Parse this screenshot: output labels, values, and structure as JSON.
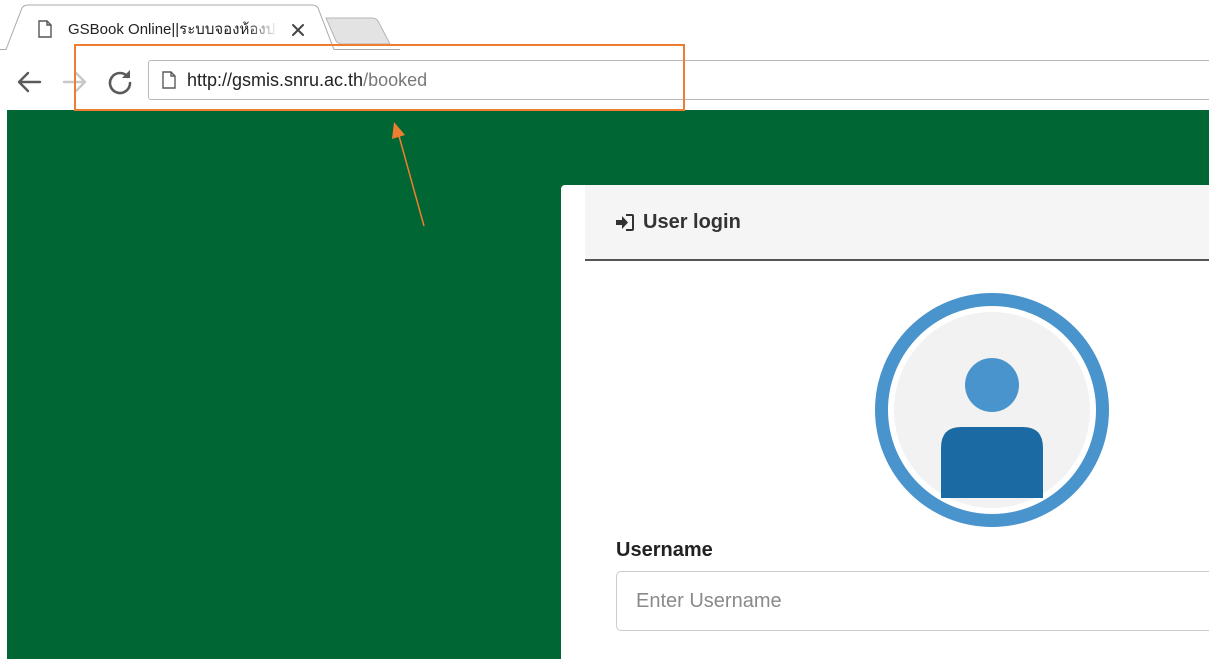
{
  "browser": {
    "tab": {
      "title": "GSBook Online||ระบบจองห้องประชุม"
    },
    "address_bar": {
      "url_host": "http://gsmis.snru.ac.th",
      "url_path": "/booked"
    }
  },
  "colors": {
    "page_background": "#006633",
    "annotation": "#ed7d31",
    "avatar_ring": "#4a94cd",
    "avatar_body": "#1b6aa3"
  },
  "login": {
    "header_title": "User login",
    "username_label": "Username",
    "username_placeholder": "Enter Username",
    "username_value": ""
  }
}
